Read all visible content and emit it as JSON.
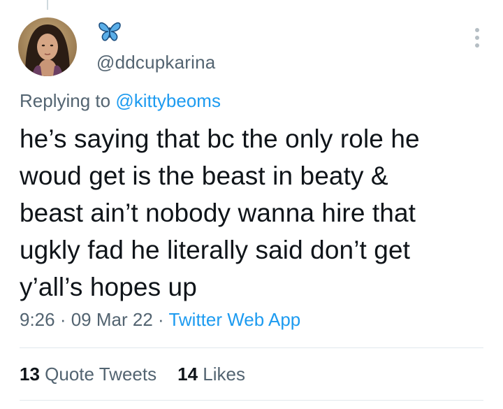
{
  "tweet": {
    "handle": "@ddcupkarina",
    "name_emoji_icon": "butterfly-icon",
    "replying_prefix": "Replying to ",
    "replying_to": "@kittybeoms",
    "text": "he’s saying that bc the only role he\nwoud get is the beast in beaty &\nbeast ain’t nobody wanna hire that\nugkly fad he literally said don’t get\ny’all’s hopes up",
    "time": "9:26",
    "sep1": " · ",
    "date": "09 Mar 22",
    "sep2": " · ",
    "source": "Twitter Web App",
    "quote_count": "13",
    "quote_label": "Quote Tweets",
    "likes_count": "14",
    "likes_label": "Likes"
  },
  "colors": {
    "accent": "#1d9bf0",
    "secondary_text": "#536471",
    "primary_text": "#0f1419"
  }
}
